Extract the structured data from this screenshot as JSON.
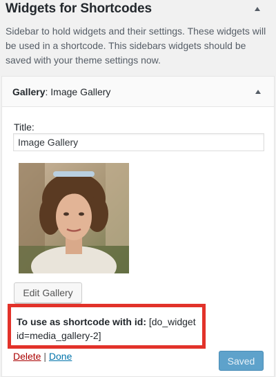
{
  "sidebar": {
    "title": "Widgets for Shortcodes",
    "description": "Sidebar to hold widgets and their settings. These widgets will be used in a shortcode. This sidebars widgets should be saved with your theme settings now.",
    "toggle_icon": "arrow-up-icon"
  },
  "widget": {
    "name": "Gallery",
    "title_suffix": ": Image Gallery",
    "toggle_icon": "arrow-up-icon",
    "title_label": "Title:",
    "title_value": "Image Gallery",
    "thumbnail": "gallery-image-portrait-woman",
    "edit_gallery_label": "Edit Gallery",
    "shortcode_label": "To use as shortcode with id:",
    "shortcode_value": "[do_widget id=media_gallery-2]",
    "delete_label": "Delete",
    "separator": "|",
    "done_label": "Done",
    "save_label": "Saved"
  },
  "colors": {
    "highlight_border": "#e2322a",
    "link": "#0073aa",
    "delete_link": "#aa0000",
    "primary_button": "#5ea2cb"
  }
}
